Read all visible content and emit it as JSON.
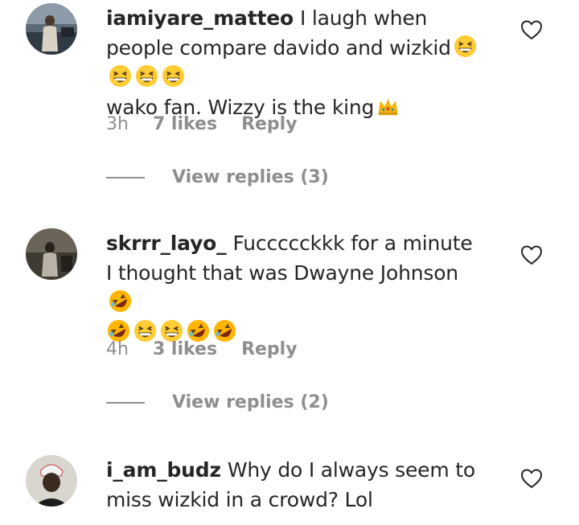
{
  "accent_colors": {
    "text": "#262626",
    "muted": "#8e8e8e",
    "background": "#ffffff"
  },
  "comments": [
    {
      "username": "iamiyare_matteo",
      "text_1": "I laugh when people compare davido and wizkid",
      "emojis_1": [
        "grinning-squint-face-emoji",
        "grinning-squint-face-emoji",
        "grinning-squint-face-emoji",
        "grinning-squint-face-emoji"
      ],
      "text_2": "wako fan. Wizzy is the king",
      "emojis_2": [
        "crown-emoji"
      ],
      "time": "3h",
      "likes": "7 likes",
      "reply": "Reply",
      "view_replies": "View replies (3)"
    },
    {
      "username": "skrrr_layo_",
      "text_1": "Fuccccckkk for a minute I thought that was Dwayne Johnson",
      "emojis_1": [
        "rolling-on-floor-laughing-emoji",
        "rolling-on-floor-laughing-emoji",
        "grinning-squint-face-emoji",
        "grinning-squint-face-emoji",
        "rolling-on-floor-laughing-emoji",
        "rolling-on-floor-laughing-emoji"
      ],
      "time": "4h",
      "likes": "3 likes",
      "reply": "Reply",
      "view_replies": "View replies (2)"
    },
    {
      "username": "i_am_budz",
      "text_1": "Why do I always seem to miss wizkid in a crowd? Lol"
    }
  ]
}
